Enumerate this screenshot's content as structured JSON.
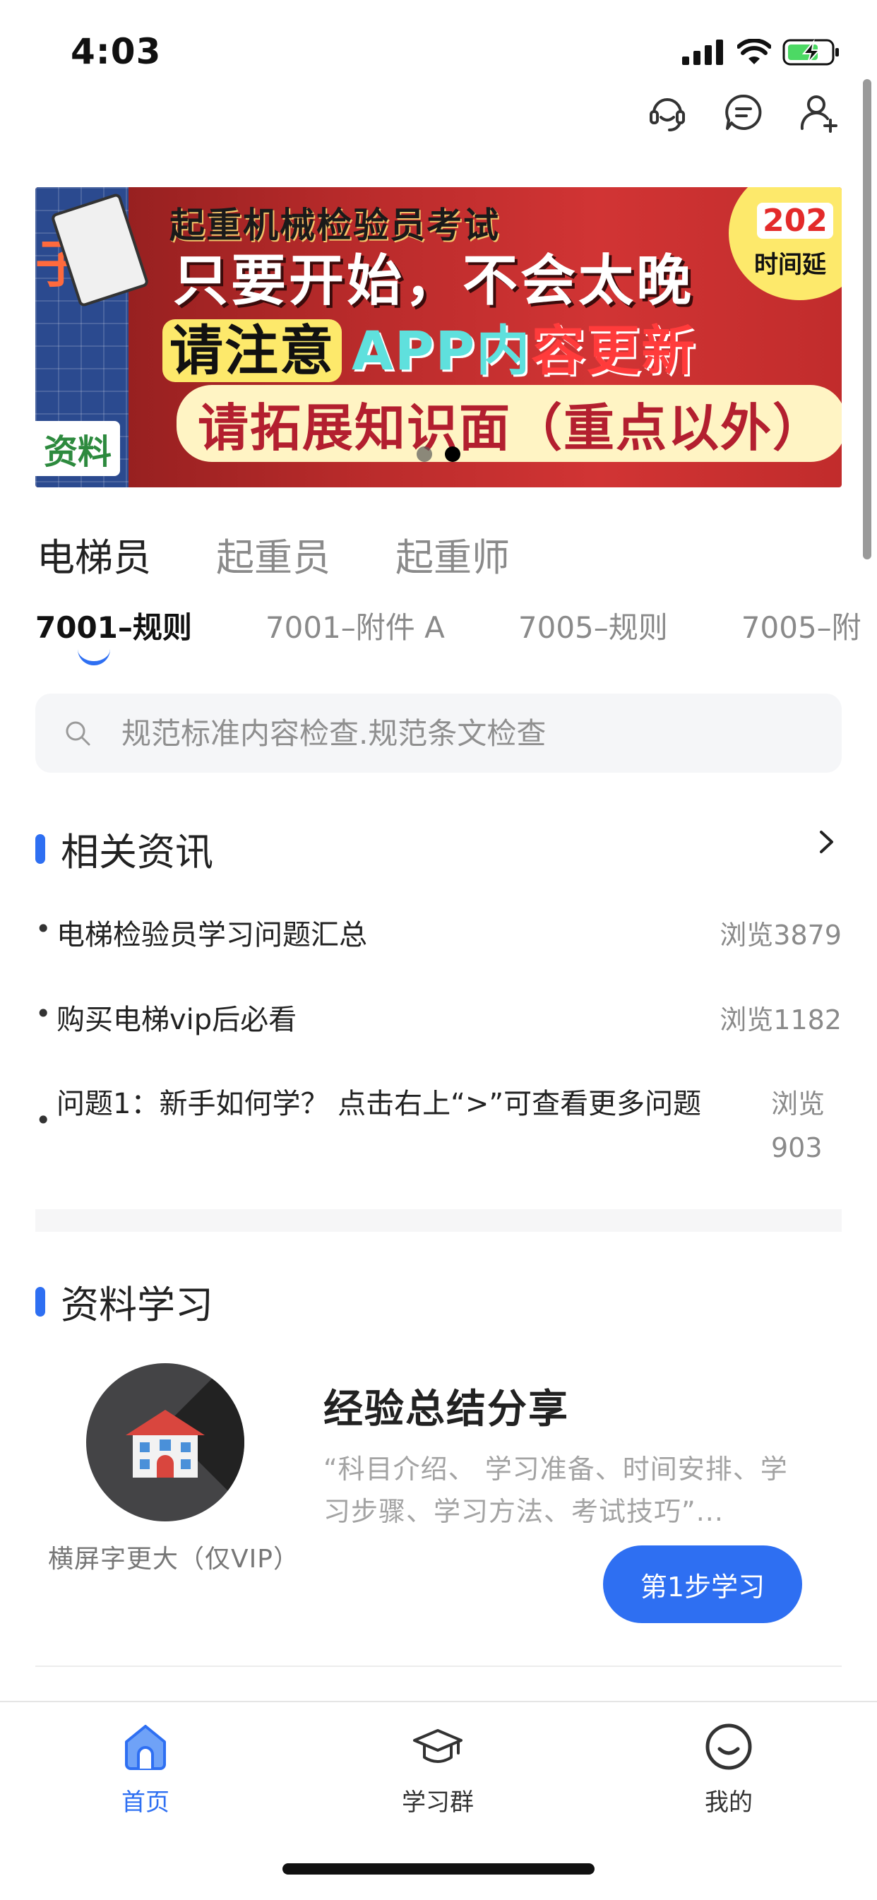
{
  "status_bar": {
    "time": "4:03"
  },
  "banner": {
    "title": "起重机械检验员考试",
    "line2": "只要开始，不会太晚",
    "line3_a": "请注意",
    "line3_b": "APP内",
    "line3_c": "容更新",
    "line4": "请拓展知识面（重点以外）",
    "badge_year": "202",
    "badge_text": "时间延",
    "left_tag": "资料",
    "page_count": 2,
    "active_page": 2
  },
  "category_tabs": [
    {
      "label": "电梯员",
      "active": true
    },
    {
      "label": "起重员",
      "active": false
    },
    {
      "label": "起重师",
      "active": false
    }
  ],
  "sub_tabs": [
    {
      "label": "7001–规则",
      "active": true
    },
    {
      "label": "7001–附件 A",
      "active": false
    },
    {
      "label": "7005–规则",
      "active": false
    },
    {
      "label": "7005–附",
      "active": false
    }
  ],
  "search": {
    "placeholder": "规范标准内容检查.规范条文检查"
  },
  "news": {
    "title": "相关资讯",
    "items": [
      {
        "bullet": "•",
        "text": "电梯检验员学习问题汇总",
        "views": "浏览3879"
      },
      {
        "bullet": "•",
        "text": "购买电梯vip后必看",
        "views": "浏览1182"
      },
      {
        "bullet": "•",
        "text": "问题1：新手如何学？ 点击右上“>”可查看更多问题",
        "views": "浏览 903"
      }
    ]
  },
  "study": {
    "section_title": "资料学习",
    "avatar_caption": "横屏字更大（仅VIP）",
    "card_title": "经验总结分享",
    "card_desc": "“科目介绍、 学习准备、时间安排、学习步骤、学习方法、考试技巧”...",
    "button_label": "第1步学习"
  },
  "bottom_nav": [
    {
      "label": "首页",
      "icon": "home-icon",
      "active": true
    },
    {
      "label": "学习群",
      "icon": "graduation-cap-icon",
      "active": false
    },
    {
      "label": "我的",
      "icon": "smile-icon",
      "active": false
    }
  ],
  "colors": {
    "accent": "#2e6ff2",
    "muted": "#8a8a8a",
    "text": "#222222"
  }
}
